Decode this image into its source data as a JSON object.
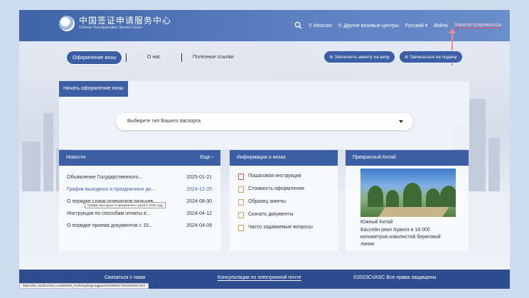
{
  "header": {
    "logo_cn": "中国签证申请服务中心",
    "logo_en": "Chinese Visa Application Service Center",
    "city": "Moscow",
    "other_centers": "Другие визовые центры",
    "language": "Русский",
    "login": "Войти",
    "register": "Зарегистрироваться"
  },
  "nav": {
    "active": "Оформление визы",
    "about": "О нас",
    "links": "Полезные ссылки",
    "fill_form": "Заполнить анкету на визу",
    "book": "Записаться на подачу"
  },
  "visa": {
    "tab": "Начать оформление визы",
    "select_placeholder": "Выберите тип Вашего паспорта"
  },
  "news": {
    "title": "Новости",
    "more": "Еще",
    "items": [
      {
        "text": "Объявление Государственного...",
        "date": "2025-01-21"
      },
      {
        "text": "График выходных и праздничных дн...",
        "date": "2024-12-25"
      },
      {
        "text": "О порядке сдачи отпечатков пальцев...",
        "date": "2024-08-30"
      },
      {
        "text": "Инструкция по способам оплаты в...",
        "date": "2024-04-12"
      },
      {
        "text": "О порядке приема документов с 15...",
        "date": "2024-04-09"
      }
    ],
    "tooltip": "График выходных и праздничных дней в 2025 году"
  },
  "info": {
    "title": "Информация о визах",
    "items": [
      "Пошаговая инструкция",
      "Стоимость оформления",
      "Образец анкеты",
      "Скачать документы",
      "Часто задаваемые вопросы"
    ]
  },
  "china": {
    "title": "Прекрасный Китай",
    "caption_title": "Южный Китай",
    "caption_text": "Бассейн реки Хуанхэ и 18 000 километров извилистой береговой линии"
  },
  "footer": {
    "contact": "Связаться с нами",
    "email": "Консультации по электронной почте",
    "copyright": "©2023CVASC Все права защищены"
  },
  "status_url": "https://bio.visaforchina.com/MOW3_RU/tongzhi/gonggao/2016680917825284048.html"
}
